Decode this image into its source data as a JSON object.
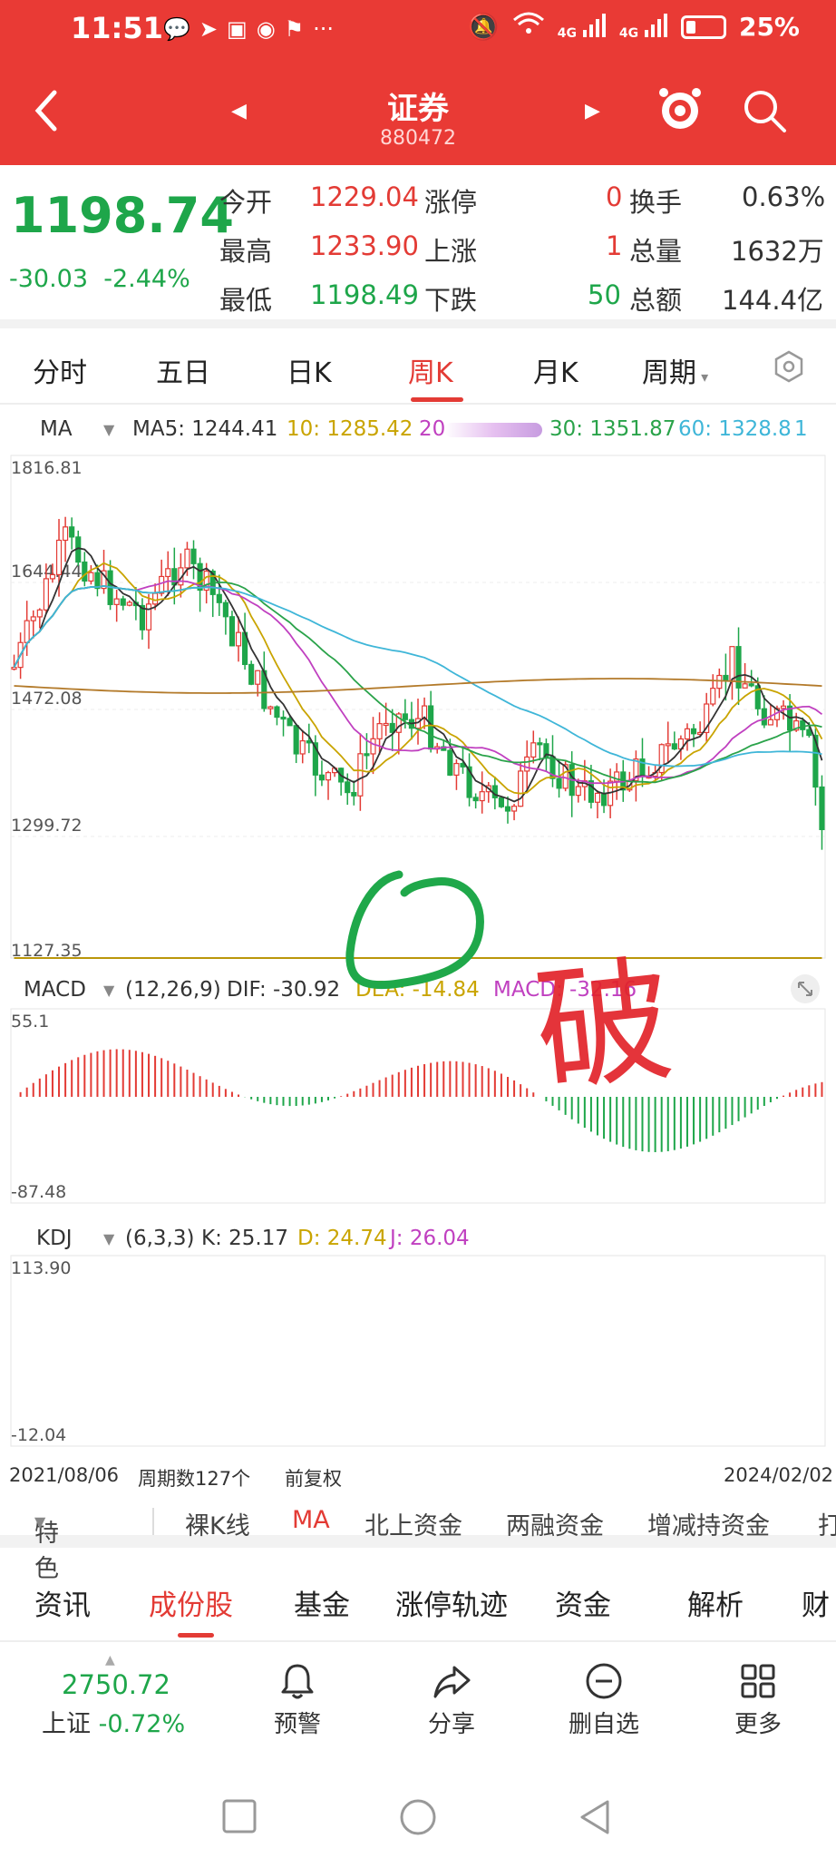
{
  "status": {
    "time": "11:51",
    "network": "4G",
    "battery": "25%",
    "battery_level": 0.25
  },
  "header": {
    "title": "证券",
    "code": "880472"
  },
  "quote": {
    "price": "1198.74",
    "change": "-30.03",
    "change_pct": "-2.44%",
    "rows": [
      {
        "l1": "今开",
        "v1": "1229.04",
        "l2": "涨停",
        "v2": "0",
        "l3": "换手",
        "v3": "0.63%"
      },
      {
        "l1": "最高",
        "v1": "1233.90",
        "l2": "上涨",
        "v2": "1",
        "l3": "总量",
        "v3": "1632万"
      },
      {
        "l1": "最低",
        "v1": "1198.49",
        "l2": "下跌",
        "v2": "50",
        "l3": "总额",
        "v3": "144.4亿"
      }
    ]
  },
  "tabs": [
    "分时",
    "五日",
    "日K",
    "周K",
    "月K",
    "周期"
  ],
  "ma": {
    "name": "MA",
    "ma5": "MA5: 1244.41",
    "ma10": "10: 1285.42",
    "ma20": "20",
    "ma30": "30: 1351.87",
    "ma60": "60: 1328.8",
    "tail": "1"
  },
  "macd": {
    "name": "MACD",
    "params": "(12,26,9)",
    "dif": "DIF: -30.92",
    "dea": "DEA: -14.84",
    "macd": "MACD: -32.16",
    "top_label": "55.1",
    "bottom_label": "-87.48"
  },
  "kdj": {
    "name": "KDJ",
    "params": "(6,3,3)",
    "k": "K: 25.17",
    "d": "D: 24.74",
    "j": "J: 26.04",
    "top_label": "113.90",
    "bottom_label": "-12.04"
  },
  "price_axis": [
    "1816.81",
    "1644.44",
    "1472.08",
    "1299.72",
    "1127.35"
  ],
  "dates": {
    "start": "2021/08/06",
    "count": "周期数127个",
    "adjust": "前复权",
    "end": "2024/02/02"
  },
  "features": [
    "特色",
    "裸K线",
    "MA",
    "北上资金",
    "两融资金",
    "增减持资金",
    "打"
  ],
  "info_tabs": [
    "资讯",
    "成份股",
    "基金",
    "涨停轨迹",
    "资金",
    "解析",
    "财"
  ],
  "index": {
    "value": "2750.72",
    "name": "上证",
    "pct": "-0.72%"
  },
  "actions": [
    "预警",
    "分享",
    "删自选",
    "更多"
  ],
  "annotation": {
    "text": "破"
  },
  "colors": {
    "red": "#e33b35",
    "green": "#1ea64a",
    "header": "#e93a35",
    "ma5": "#333333",
    "ma10": "#c9a400",
    "ma20": "#c040c0",
    "ma30": "#2aa34a",
    "ma60": "#3fb6d8"
  }
}
